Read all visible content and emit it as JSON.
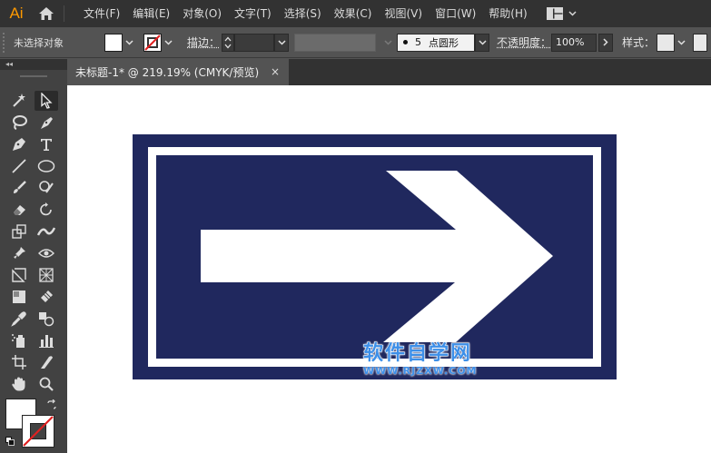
{
  "app": {
    "logo": "Ai"
  },
  "menu": {
    "items": [
      "文件(F)",
      "编辑(E)",
      "对象(O)",
      "文字(T)",
      "选择(S)",
      "效果(C)",
      "视图(V)",
      "窗口(W)",
      "帮助(H)"
    ]
  },
  "control": {
    "selection_label": "未选择对象",
    "stroke_label": "描边：",
    "brush_size": "5",
    "brush_shape": "点圆形",
    "opacity_label": "不透明度：",
    "opacity_value": "100%",
    "style_label": "样式："
  },
  "tools_panel": {
    "collapse": "◂◂"
  },
  "document": {
    "tab_title": "未标题-1* @ 219.19% (CMYK/预览)",
    "close": "×"
  },
  "artwork": {
    "sign_color": "#20285e",
    "border_color": "#ffffff",
    "arrow_color": "#ffffff"
  },
  "watermark": {
    "title": "软件自学网",
    "url": "WWW.RJZXW.COM"
  },
  "colors": {
    "menubar": "#323232",
    "panel": "#535353",
    "toolbar": "#424242",
    "logo": "#ff9a00",
    "watermark": "#3d8fe8"
  }
}
